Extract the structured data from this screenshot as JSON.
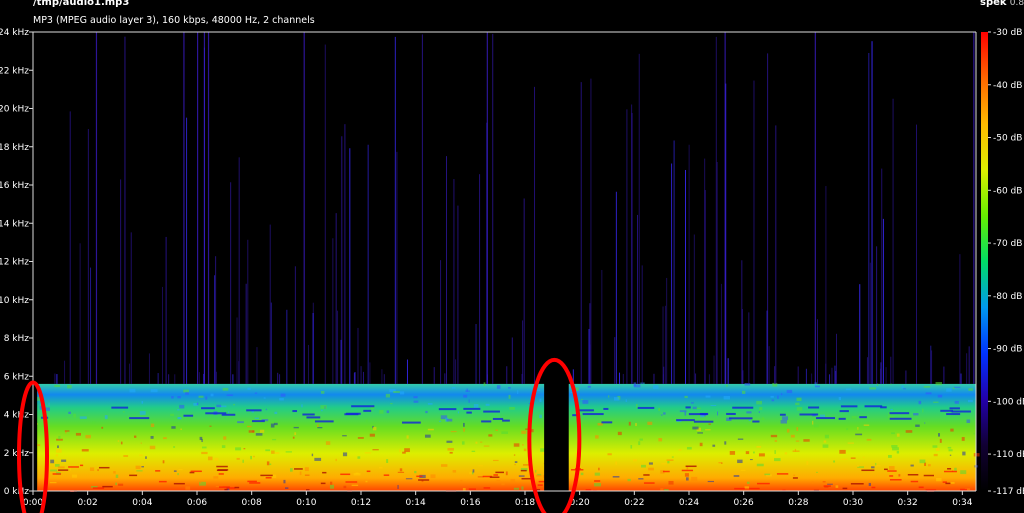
{
  "header": {
    "file_path": "/tmp/audio1.mp3",
    "info": "MP3 (MPEG audio layer 3), 160 kbps, 48000 Hz, 2 channels",
    "app_name": "spek",
    "app_version": "0.8"
  },
  "chart_data": {
    "type": "heatmap",
    "title": "/tmp/audio1.mp3",
    "subtitle": "MP3 (MPEG audio layer 3), 160 kbps, 48000 Hz, 2 channels",
    "xlabel": "",
    "ylabel": "",
    "x_unit": "time (m:ss)",
    "y_unit": "kHz",
    "xlim": [
      "0:00",
      "0:34.5"
    ],
    "ylim_khz": [
      0,
      24
    ],
    "x_ticks": [
      "0:00",
      "0:02",
      "0:04",
      "0:06",
      "0:08",
      "0:10",
      "0:12",
      "0:14",
      "0:16",
      "0:18",
      "0:20",
      "0:22",
      "0:24",
      "0:26",
      "0:28",
      "0:30",
      "0:32",
      "0:34"
    ],
    "y_ticks": [
      "0 kHz",
      "2 kHz",
      "4 kHz",
      "6 kHz",
      "8 kHz",
      "10 kHz",
      "12 kHz",
      "14 kHz",
      "16 kHz",
      "18 kHz",
      "20 kHz",
      "22 kHz",
      "24 kHz"
    ],
    "colorbar": {
      "range_db": [
        -117,
        -30
      ],
      "labels": [
        "-30 dB",
        "-40 dB",
        "-50 dB",
        "-60 dB",
        "-70 dB",
        "-80 dB",
        "-90 dB",
        "-100 dB",
        "-110 dB",
        "-117 dB"
      ],
      "stops": [
        "#ff0000",
        "#ff6600",
        "#ffbb00",
        "#ddee00",
        "#66ee00",
        "#00dd66",
        "#0099ee",
        "#0033ff",
        "#2200aa",
        "#110033",
        "#000000"
      ]
    },
    "spectrum": {
      "cutoff_khz": 5.6,
      "silent_gap_seconds": [
        18.7,
        19.6
      ],
      "onset_seconds": [
        0.0,
        0.15
      ]
    },
    "annotations": [
      {
        "shape": "ellipse",
        "color": "#ff0000",
        "center_time": "0:00",
        "center_khz": 2.8
      },
      {
        "shape": "ellipse",
        "color": "#ff0000",
        "center_time": "0:19",
        "center_khz": 3.3
      }
    ]
  }
}
